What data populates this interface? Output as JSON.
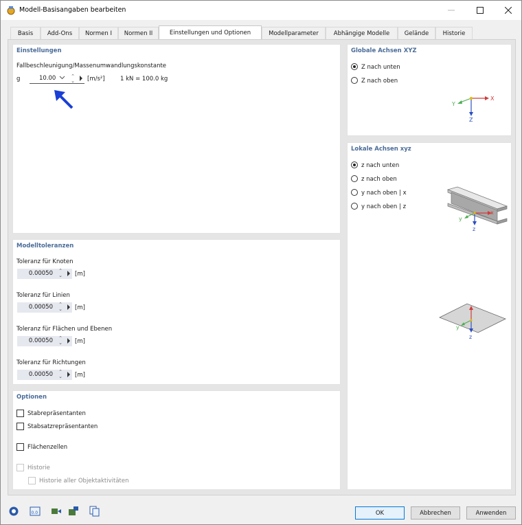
{
  "window": {
    "title": "Modell-Basisangaben bearbeiten",
    "min_icon": "minimize-icon",
    "max_icon": "maximize-icon",
    "close_icon": "close-icon"
  },
  "tabs": [
    {
      "label": "Basis"
    },
    {
      "label": "Add-Ons"
    },
    {
      "label": "Normen I"
    },
    {
      "label": "Normen II"
    },
    {
      "label": "Einstellungen und Optionen"
    },
    {
      "label": "Modellparameter"
    },
    {
      "label": "Abhängige Modelle"
    },
    {
      "label": "Gelände"
    },
    {
      "label": "Historie"
    }
  ],
  "active_tab": "Einstellungen und Optionen",
  "einstellungen": {
    "title": "Einstellungen",
    "label": "Fallbeschleunigung/Massenumwandlungskonstante",
    "symbol": "g",
    "value": "10.00",
    "unit": "[m/s²]",
    "conversion": "1 kN = 100.0 kg"
  },
  "toleranzen": {
    "title": "Modelltoleranzen",
    "items": [
      {
        "label": "Toleranz für Knoten",
        "value": "0.00050",
        "unit": "[m]"
      },
      {
        "label": "Toleranz für Linien",
        "value": "0.00050",
        "unit": "[m]"
      },
      {
        "label": "Toleranz für Flächen und Ebenen",
        "value": "0.00050",
        "unit": "[m]"
      },
      {
        "label": "Toleranz für Richtungen",
        "value": "0.00050",
        "unit": "[m]"
      }
    ]
  },
  "optionen": {
    "title": "Optionen",
    "items": [
      {
        "label": "Stabrepräsentanten",
        "checked": false,
        "enabled": true
      },
      {
        "label": "Stabsatzrepräsentanten",
        "checked": false,
        "enabled": true
      },
      {
        "label": "Flächenzellen",
        "checked": false,
        "enabled": true
      },
      {
        "label": "Historie",
        "checked": false,
        "enabled": false
      },
      {
        "label": "Historie aller Objektaktivitäten",
        "checked": false,
        "enabled": false
      }
    ]
  },
  "global_axes": {
    "title": "Globale Achsen XYZ",
    "options": [
      {
        "label": "Z nach unten",
        "selected": true
      },
      {
        "label": "Z nach oben",
        "selected": false
      }
    ],
    "diagram_labels": {
      "x": "X",
      "y": "Y",
      "z": "Z"
    }
  },
  "local_axes": {
    "title": "Lokale Achsen xyz",
    "options": [
      {
        "label": "z nach unten",
        "selected": true
      },
      {
        "label": "z nach oben",
        "selected": false
      },
      {
        "label": "y nach oben | x",
        "selected": false
      },
      {
        "label": "y nach oben | z",
        "selected": false
      }
    ],
    "diagram_labels": {
      "x": "x",
      "y": "y",
      "z": "z"
    }
  },
  "footer": {
    "icons": [
      "help-icon",
      "units-icon",
      "load-icon",
      "save-icon",
      "copy-icon"
    ],
    "ok": "OK",
    "cancel": "Abbrechen",
    "apply": "Anwenden"
  },
  "colors": {
    "panel_title": "#4a6c98",
    "arrow": "#1a3fd6",
    "field_bg": "#e6e8ef",
    "ok_border": "#0078d7"
  }
}
